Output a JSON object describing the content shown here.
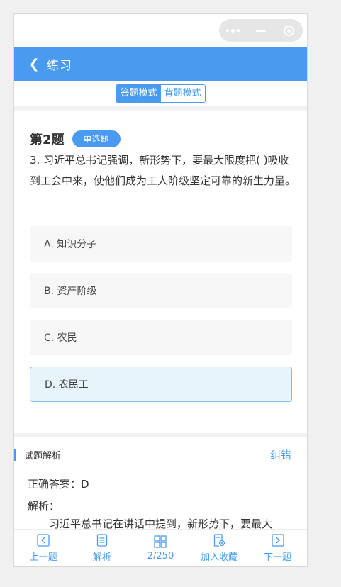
{
  "nav": {
    "title": "练习"
  },
  "modes": {
    "answer_mode": "答题模式",
    "recite_mode": "背题模式"
  },
  "question": {
    "number": "第2题",
    "type": "单选题",
    "text": "3. 习近平总书记强调，新形势下，要最大限度把( )吸收到工会中来，使他们成为工人阶级坚定可靠的新生力量。",
    "options": [
      {
        "label": "A. 知识分子"
      },
      {
        "label": "B. 资产阶级"
      },
      {
        "label": "C. 农民"
      },
      {
        "label": "D. 农民工"
      }
    ],
    "selected": "D"
  },
  "analysis": {
    "title": "试题解析",
    "correct_link": "纠错",
    "correct_answer": "正确答案：D",
    "label": "解析：",
    "text": "习近平总书记在讲话中提到，新形势下，要最大"
  },
  "tabbar": {
    "prev": "上一题",
    "analysis": "解析",
    "progress": "2/250",
    "favorite": "加入收藏",
    "next": "下一题"
  },
  "colors": {
    "accent": "#4a9bf0",
    "selected_bg": "#e8f4fb",
    "selected_border": "#7cc0e6"
  },
  "icons": [
    "more-dots-icon",
    "minimize-icon",
    "close-target-icon",
    "back-chevron-icon",
    "prev-icon",
    "analysis-doc-icon",
    "grid-icon",
    "favorite-icon",
    "next-icon"
  ]
}
